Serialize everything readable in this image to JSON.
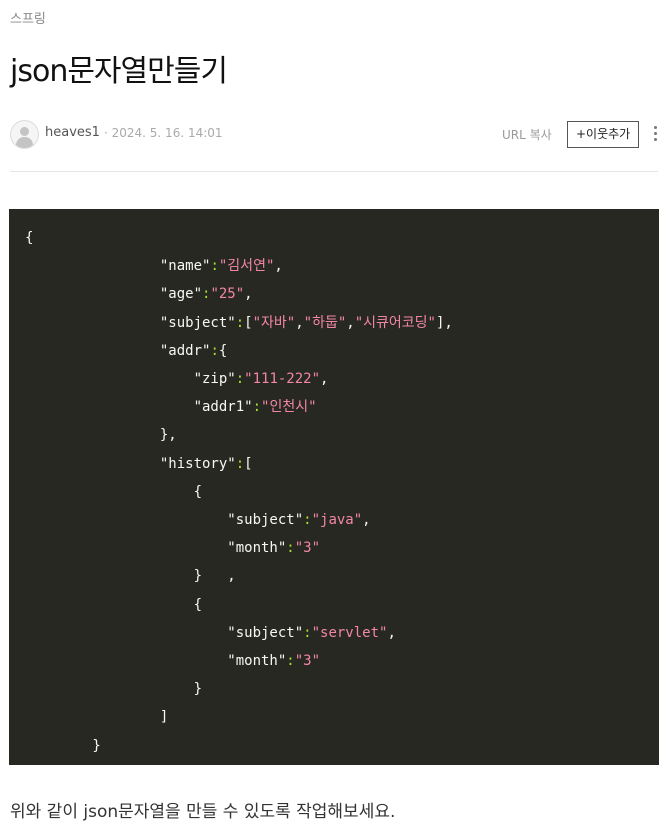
{
  "post": {
    "category": "스프링",
    "title": "json문자열만들기",
    "author": "heaves1",
    "date": "· 2024. 5. 16. 14:01",
    "url_copy_label": "URL 복사",
    "add_neighbor_label": "+이웃추가",
    "body_text": "위와 같이 json문자열을 만들 수 있도록 작업해보세요."
  },
  "code_lines": [
    [
      {
        "t": "{",
        "c": "k"
      }
    ],
    [
      {
        "t": "                \"name\"",
        "c": "k"
      },
      {
        "t": ":",
        "c": "p"
      },
      {
        "t": "\"김서연\"",
        "c": "s"
      },
      {
        "t": ",",
        "c": "k"
      }
    ],
    [
      {
        "t": "                \"age\"",
        "c": "k"
      },
      {
        "t": ":",
        "c": "p"
      },
      {
        "t": "\"25\"",
        "c": "s"
      },
      {
        "t": ",",
        "c": "k"
      }
    ],
    [
      {
        "t": "                \"subject\"",
        "c": "k"
      },
      {
        "t": ":",
        "c": "p"
      },
      {
        "t": "[",
        "c": "k"
      },
      {
        "t": "\"자바\"",
        "c": "s"
      },
      {
        "t": ",",
        "c": "k"
      },
      {
        "t": "\"하둡\"",
        "c": "s"
      },
      {
        "t": ",",
        "c": "k"
      },
      {
        "t": "\"시큐어코딩\"",
        "c": "s"
      },
      {
        "t": "],",
        "c": "k"
      }
    ],
    [
      {
        "t": "                \"addr\"",
        "c": "k"
      },
      {
        "t": ":",
        "c": "p"
      },
      {
        "t": "{",
        "c": "k"
      }
    ],
    [
      {
        "t": "                    \"zip\"",
        "c": "k"
      },
      {
        "t": ":",
        "c": "p"
      },
      {
        "t": "\"111-222\"",
        "c": "s"
      },
      {
        "t": ",",
        "c": "k"
      }
    ],
    [
      {
        "t": "                    \"addr1\"",
        "c": "k"
      },
      {
        "t": ":",
        "c": "p"
      },
      {
        "t": "\"인천시\"",
        "c": "s"
      }
    ],
    [
      {
        "t": "                },",
        "c": "k"
      }
    ],
    [
      {
        "t": "                \"history\"",
        "c": "k"
      },
      {
        "t": ":",
        "c": "p"
      },
      {
        "t": "[",
        "c": "k"
      }
    ],
    [
      {
        "t": "                    {",
        "c": "k"
      }
    ],
    [
      {
        "t": "                        \"subject\"",
        "c": "k"
      },
      {
        "t": ":",
        "c": "p"
      },
      {
        "t": "\"java\"",
        "c": "s"
      },
      {
        "t": ",",
        "c": "k"
      }
    ],
    [
      {
        "t": "                        \"month\"",
        "c": "k"
      },
      {
        "t": ":",
        "c": "p"
      },
      {
        "t": "\"3\"",
        "c": "s"
      }
    ],
    [
      {
        "t": "                    }   ,",
        "c": "k"
      }
    ],
    [
      {
        "t": "                    {",
        "c": "k"
      }
    ],
    [
      {
        "t": "                        \"subject\"",
        "c": "k"
      },
      {
        "t": ":",
        "c": "p"
      },
      {
        "t": "\"servlet\"",
        "c": "s"
      },
      {
        "t": ",",
        "c": "k"
      }
    ],
    [
      {
        "t": "                        \"month\"",
        "c": "k"
      },
      {
        "t": ":",
        "c": "p"
      },
      {
        "t": "\"3\"",
        "c": "s"
      }
    ],
    [
      {
        "t": "                    }",
        "c": "k"
      }
    ],
    [
      {
        "t": "                ]",
        "c": "k"
      }
    ],
    [
      {
        "t": "        }",
        "c": "k"
      }
    ]
  ]
}
